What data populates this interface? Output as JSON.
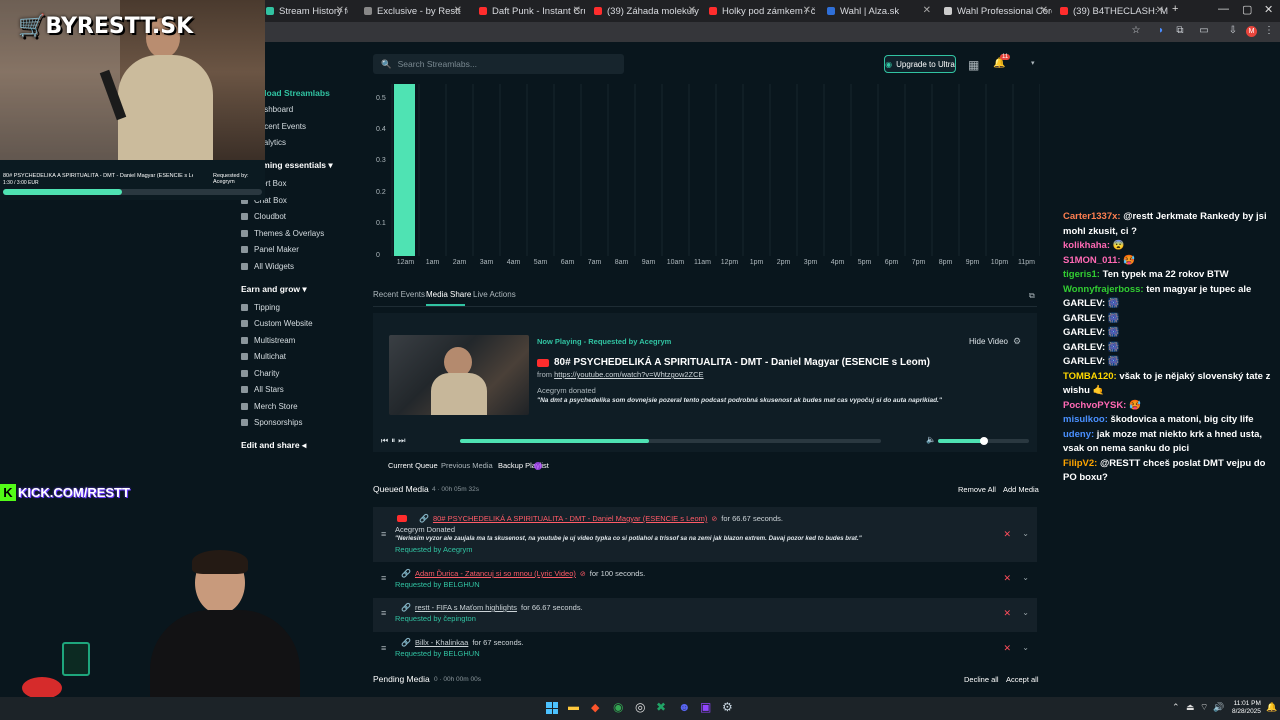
{
  "browser": {
    "tabs": [
      {
        "label": "Stream History for 8lerp Sl",
        "color": "#31c3a2"
      },
      {
        "label": "Exclusive - by Restt",
        "color": "#888888"
      },
      {
        "label": "Daft Punk - Instant Crush (Vid",
        "color": "#ff2d2d"
      },
      {
        "label": "(39) Záhada molekuly DMT a j",
        "color": "#ff2d2d"
      },
      {
        "label": "Holky pod zámkem / část 1 - d",
        "color": "#ff2d2d"
      },
      {
        "label": "Wahl | Alza.sk",
        "color": "#2f6fd8"
      },
      {
        "label": "Wahl Professional Cordless De",
        "color": "#cccccc"
      },
      {
        "label": "(39) B4THECLASH: Maoge",
        "color": "#ff2d2d"
      }
    ],
    "new_tab": "+",
    "profile_initial": "M"
  },
  "overlay": {
    "brand": "BYRESTT.SK",
    "now_playing": "80# PSYCHEDELIKÁ A SPIRITUALITA - DMT - Daniel Magyar (ESENCIE s Leom)",
    "requested_by": "Requested by: Acegrym",
    "progress_text": "1:30 / 3:00 EUR",
    "kick_label": "KICK.COM/RESTT"
  },
  "streamlabs": {
    "search_placeholder": "Search Streamlabs...",
    "upgrade_label": "Upgrade to Ultra",
    "notif_count": "11",
    "sidebar": {
      "download": "Download Streamlabs",
      "items_top": [
        "Dashboard",
        "Recent Events",
        "Analytics"
      ],
      "section1": "Streaming essentials",
      "items1": [
        "Alert Box",
        "Chat Box",
        "Cloudbot",
        "Themes & Overlays",
        "Panel Maker",
        "All Widgets"
      ],
      "section2": "Earn and grow",
      "items2": [
        "Tipping",
        "Custom Website",
        "Multistream",
        "Multichat",
        "Charity",
        "All Stars",
        "Merch Store",
        "Sponsorships"
      ],
      "section3": "Edit and share"
    }
  },
  "chart_data": {
    "type": "bar",
    "categories": [
      "12am",
      "1am",
      "2am",
      "3am",
      "4am",
      "5am",
      "6am",
      "7am",
      "8am",
      "9am",
      "10am",
      "11am",
      "12pm",
      "1pm",
      "2pm",
      "3pm",
      "4pm",
      "5pm",
      "6pm",
      "7pm",
      "8pm",
      "9pm",
      "10pm",
      "11pm"
    ],
    "values": [
      0.55,
      0,
      0,
      0,
      0,
      0,
      0,
      0,
      0,
      0,
      0,
      0,
      0,
      0,
      0,
      0,
      0,
      0,
      0,
      0,
      0,
      0,
      0,
      0
    ],
    "yticks": [
      "0.5",
      "0.4",
      "0.3",
      "0.2",
      "0.1",
      "0"
    ],
    "ylim": [
      0,
      0.55
    ],
    "bar_color": "#4fe3b3",
    "grid": true
  },
  "panel_tabs": [
    "Recent Events",
    "Media Share",
    "Live Actions"
  ],
  "now_playing": {
    "header": "Now Playing - Requested by Acegrym",
    "title": "80# PSYCHEDELIKÁ A SPIRITUALITA - DMT - Daniel Magyar (ESENCIE s Leom)",
    "from_label": "from",
    "url": "https://youtube.com/watch?v=Whtzgow2ZCE",
    "donor": "Acegrym donated",
    "message": "\"Na dmt a psychedelika som dovnejsie pozeral tento podcast podrobná skusenost ak budes mat cas vypočuj si do auta naprikiad.\"",
    "hide_video": "Hide Video",
    "progress": 0.45,
    "volume": 0.5
  },
  "queue_tabs": [
    "Current Queue",
    "Previous Media",
    "Backup Playlist"
  ],
  "queued": {
    "title": "Queued Media",
    "duration": "4 · 00h 05m 32s",
    "remove_all": "Remove All",
    "add_media": "Add Media",
    "items": [
      {
        "title": "80# PSYCHEDELIKÁ A SPIRITUALITA - DMT - Daniel Magyar (ESENCIE s Leom)",
        "seconds": "for 66.67 seconds.",
        "donor": "Acegrym Donated",
        "message": "\"Neriesim vyzor ale zaujala ma ta skusenost, na youtube je uj video typka co si potiahol a trissof sa na zemi jak blazon extrem. Davaj pozor ked to budes brat.\"",
        "requested": "Requested by Acegrym"
      },
      {
        "title": "Adam Ďurica - Zatancuj si so mnou (Lyric Video)",
        "seconds": "for 100 seconds.",
        "requested": "Requested by BELGHUN"
      },
      {
        "title": "restt - FIFA s Maťom highlights",
        "seconds": "for 66.67 seconds.",
        "requested": "Requested by čepington"
      },
      {
        "title": "Billx - Khalinkaa",
        "seconds": "for 67 seconds.",
        "requested": "Requested by BELGHUN"
      }
    ]
  },
  "pending": {
    "title": "Pending Media",
    "duration": "0 · 00h 00m 00s",
    "decline_all": "Decline all",
    "accept_all": "Accept all"
  },
  "chat": [
    {
      "user": "Carter1337x:",
      "user_color": "#ff7f50",
      "text": "@restt Jerkmate Rankedy by jsi mohl zkusit, ci ?"
    },
    {
      "user": "kolikhaha:",
      "user_color": "#ff69b4",
      "text": "😨"
    },
    {
      "user": "S1MON_011:",
      "user_color": "#ff69b4",
      "text": "🥵"
    },
    {
      "user": "tigeris1:",
      "user_color": "#32cd32",
      "text": "Ten typek ma 22 rokov BTW"
    },
    {
      "user": "Wonnyfrajerboss:",
      "user_color": "#32cd32",
      "text": "ten magyar je tupec ale"
    },
    {
      "user": "GARLEV:",
      "user_color": "#ffffff",
      "text": "🎆"
    },
    {
      "user": "GARLEV:",
      "user_color": "#ffffff",
      "text": "🎆"
    },
    {
      "user": "GARLEV:",
      "user_color": "#ffffff",
      "text": "🎆"
    },
    {
      "user": "GARLEV:",
      "user_color": "#ffffff",
      "text": "🎆"
    },
    {
      "user": "GARLEV:",
      "user_color": "#ffffff",
      "text": "🎆"
    },
    {
      "user": "TOMBA120:",
      "user_color": "#ffd700",
      "text": "však to je nějaký slovenský tate z wishu 🤙"
    },
    {
      "user": "PochvoPYSK:",
      "user_color": "#ff69b4",
      "text": "🥵"
    },
    {
      "user": "misulkoo:",
      "user_color": "#4a90ff",
      "text": "škodovica a matoni, big city life"
    },
    {
      "user": "udeny:",
      "user_color": "#4a90ff",
      "text": "jak moze mat niekto krk a hned usta, vsak on nema sanku do pici"
    },
    {
      "user": "FilipV2:",
      "user_color": "#ffa500",
      "text": "@RESTT chceš poslat DMT vejpu do PO boxu?"
    }
  ],
  "taskbar": {
    "time": "11:01 PM",
    "date": "8/28/2025"
  }
}
